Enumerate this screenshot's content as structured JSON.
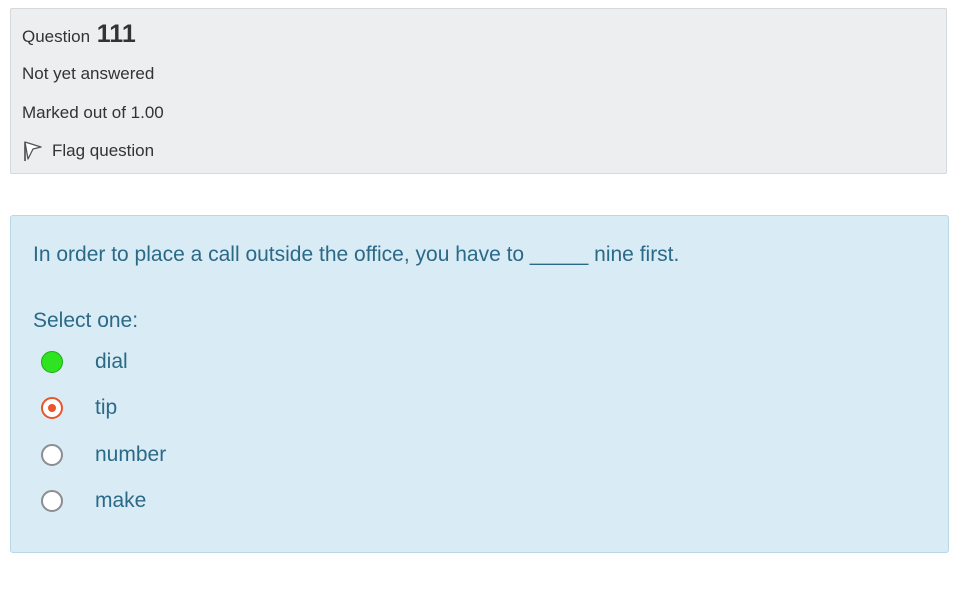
{
  "info": {
    "question_label": "Question",
    "question_number": "111",
    "state": "Not yet answered",
    "grade": "Marked out of 1.00",
    "flag_label": "Flag question"
  },
  "formulation": {
    "question_text": "In order to place a call outside the office, you have to _____ nine first.",
    "prompt": "Select one:",
    "answers": [
      {
        "label": "dial",
        "state": "highlighted"
      },
      {
        "label": "tip",
        "state": "selected"
      },
      {
        "label": "number",
        "state": "unselected"
      },
      {
        "label": "make",
        "state": "unselected"
      }
    ]
  },
  "colors": {
    "info_background": "#eceef0",
    "formulation_background": "#d9ebf5",
    "formulation_text": "#2b6a87",
    "highlight_green": "#2ee320",
    "selected_radio": "#e8552a"
  },
  "icons": {
    "flag": "flag-icon"
  }
}
